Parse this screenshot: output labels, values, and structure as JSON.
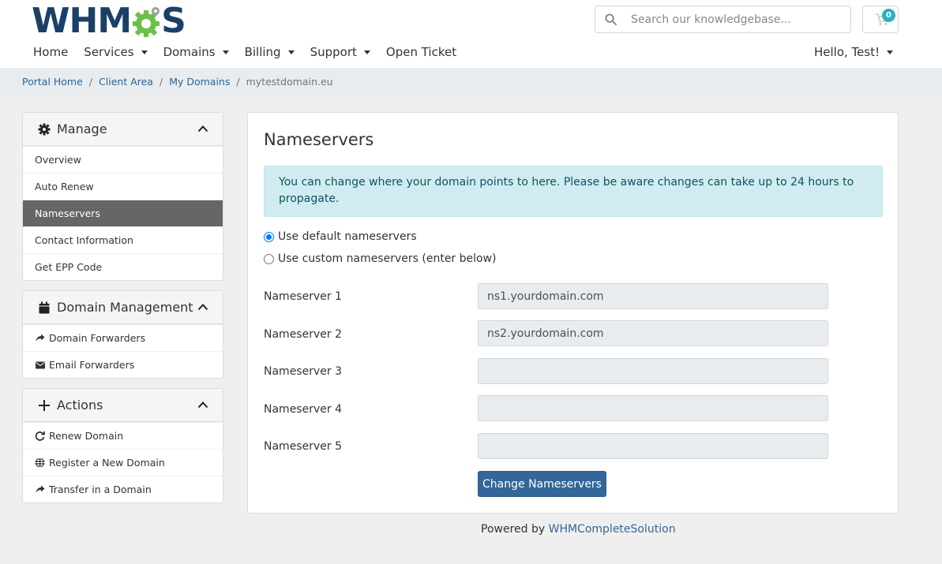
{
  "brand": {
    "logo_text_left": "WHM",
    "logo_text_right": "S"
  },
  "search": {
    "placeholder": "Search our knowledgebase..."
  },
  "cart": {
    "count": "0"
  },
  "nav": {
    "home": "Home",
    "services": "Services",
    "domains": "Domains",
    "billing": "Billing",
    "support": "Support",
    "open_ticket": "Open Ticket",
    "user": "Hello, Test!"
  },
  "breadcrumb": {
    "items": [
      "Portal Home",
      "Client Area",
      "My Domains"
    ],
    "separator": "/",
    "current": "mytestdomain.eu"
  },
  "sidebar": {
    "manage": {
      "title": "Manage",
      "items": [
        "Overview",
        "Auto Renew",
        "Nameservers",
        "Contact Information",
        "Get EPP Code"
      ],
      "active": "Nameservers"
    },
    "domain_management": {
      "title": "Domain Management",
      "items": [
        "Domain Forwarders",
        "Email Forwarders"
      ]
    },
    "actions": {
      "title": "Actions",
      "items": [
        "Renew Domain",
        "Register a New Domain",
        "Transfer in a Domain"
      ]
    }
  },
  "main": {
    "title": "Nameservers",
    "alert": "You can change where your domain points to here. Please be aware changes can take up to 24 hours to propagate.",
    "radio_default": "Use default nameservers",
    "radio_custom": "Use custom nameservers (enter below)",
    "selected_option": "default",
    "nameservers": [
      {
        "label": "Nameserver 1",
        "value": "ns1.yourdomain.com"
      },
      {
        "label": "Nameserver 2",
        "value": "ns2.yourdomain.com"
      },
      {
        "label": "Nameserver 3",
        "value": ""
      },
      {
        "label": "Nameserver 4",
        "value": ""
      },
      {
        "label": "Nameserver 5",
        "value": ""
      }
    ],
    "submit_label": "Change Nameservers"
  },
  "footer": {
    "prefix": "Powered by",
    "link": "WHMCompleteSolution"
  },
  "colors": {
    "brand_navy": "#1b4068",
    "brand_green": "#6cc04a",
    "link": "#2a6496",
    "primary_button": "#336699",
    "active_item": "#666666",
    "alert_bg": "#d1ecf1",
    "badge": "#2bb0c4"
  }
}
